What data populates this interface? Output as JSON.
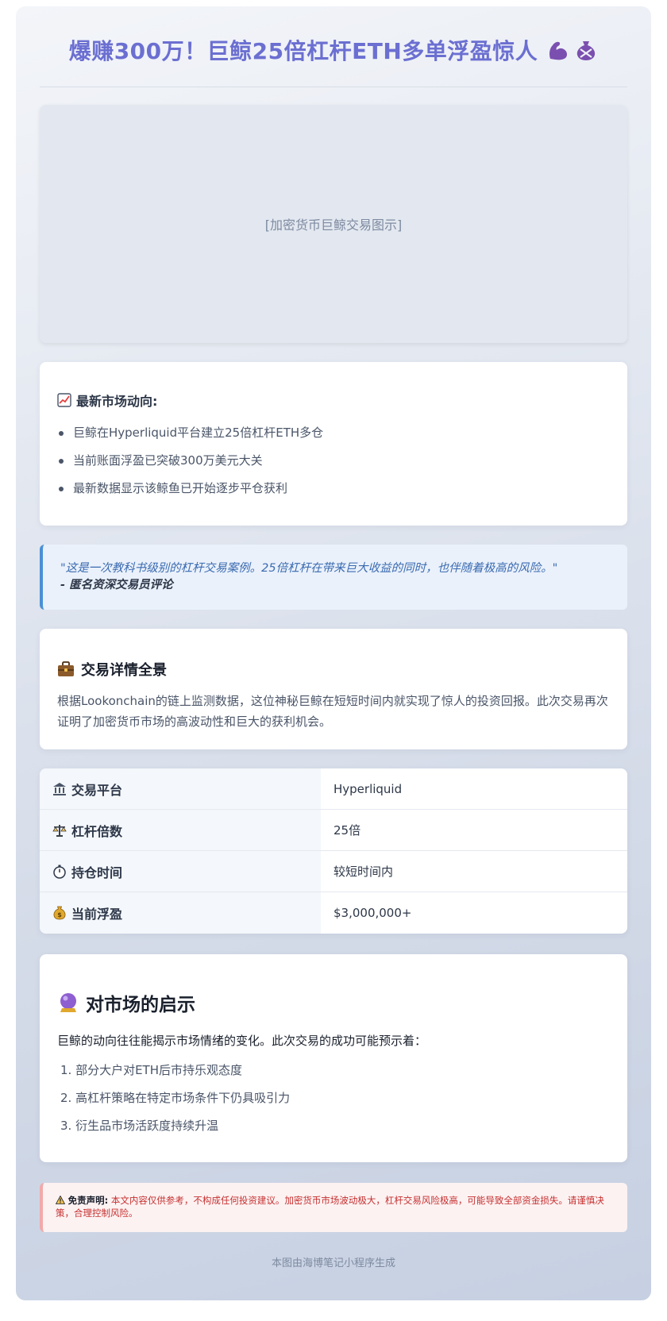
{
  "header": {
    "title": "爆赚300万！巨鲸25倍杠杆ETH多单浮盈惊人",
    "icons": [
      "flexed-bicep-icon",
      "money-bag-icon"
    ]
  },
  "image_placeholder": "[加密货币巨鲸交易图示]",
  "news": {
    "heading": "最新市场动向:",
    "icon": "chart-increasing-icon",
    "items": [
      "巨鲸在Hyperliquid平台建立25倍杠杆ETH多仓",
      "当前账面浮盈已突破300万美元大关",
      "最新数据显示该鲸鱼已开始逐步平仓获利"
    ]
  },
  "quote": {
    "text": "\"这是一次教科书级别的杠杆交易案例。25倍杠杆在带来巨大收益的同时，也伴随着极高的风险。\"",
    "author": "- 匿名资深交易员评论"
  },
  "detail": {
    "heading": "交易详情全景",
    "icon": "briefcase-icon",
    "body": "根据Lookonchain的链上监测数据，这位神秘巨鲸在短短时间内就实现了惊人的投资回报。此次交易再次证明了加密货币市场的高波动性和巨大的获利机会。"
  },
  "table": {
    "rows": [
      {
        "icon": "bank-icon",
        "key": "交易平台",
        "value": "Hyperliquid"
      },
      {
        "icon": "balance-scale-icon",
        "key": "杠杆倍数",
        "value": "25倍"
      },
      {
        "icon": "stopwatch-icon",
        "key": "持仓时间",
        "value": "较短时间内"
      },
      {
        "icon": "money-bag-icon",
        "key": "当前浮盈",
        "value": "$3,000,000+"
      }
    ]
  },
  "insight": {
    "heading": "对市场的启示",
    "icon": "crystal-ball-icon",
    "intro": "巨鲸的动向往往能揭示市场情绪的变化。此次交易的成功可能预示着：",
    "items": [
      "1. 部分大户对ETH后市持乐观态度",
      "2. 高杠杆策略在特定市场条件下仍具吸引力",
      "3. 衍生品市场活跃度持续升温"
    ]
  },
  "disclaimer": {
    "label": "免责声明:",
    "text": "本文内容仅供参考，不构成任何投资建议。加密货币市场波动极大，杠杆交易风险极高，可能导致全部资金损失。请谨慎决策，合理控制风险。"
  },
  "footer": "本图由海博笔记小程序生成",
  "colors": {
    "title": "#6b6fd1",
    "quote_border": "#4a90d6",
    "disclaimer_text": "#c53030"
  }
}
